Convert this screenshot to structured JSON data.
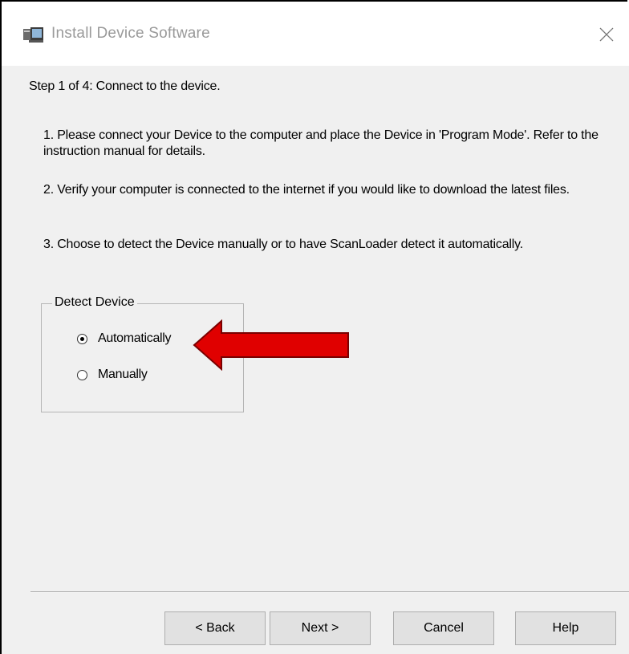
{
  "window": {
    "title": "Install Device Software",
    "close_glyph": "×"
  },
  "step": {
    "text": "Step 1 of 4:  Connect to the device."
  },
  "instructions": [
    "1.  Please connect your Device to the computer and place the Device in 'Program Mode'.  Refer to the instruction manual for details.",
    "2.  Verify your computer is connected to the internet if you would like to download the latest files.",
    "3.  Choose to detect the Device manually or to have ScanLoader detect it automatically."
  ],
  "detect_device": {
    "label": "Detect Device",
    "options": [
      {
        "label": "Automatically",
        "selected": true
      },
      {
        "label": "Manually",
        "selected": false
      }
    ]
  },
  "annotation": {
    "type": "arrow",
    "color": "#e00000",
    "points_to": "Automatically"
  },
  "buttons": {
    "back": "< Back",
    "next": "Next >",
    "cancel": "Cancel",
    "help": "Help"
  },
  "colors": {
    "dialog_background": "#f0f0f0",
    "title_text": "#9a9a9a",
    "arrow": "#e00000"
  },
  "icons": {
    "app": "install-device-icon",
    "close": "close-icon"
  }
}
